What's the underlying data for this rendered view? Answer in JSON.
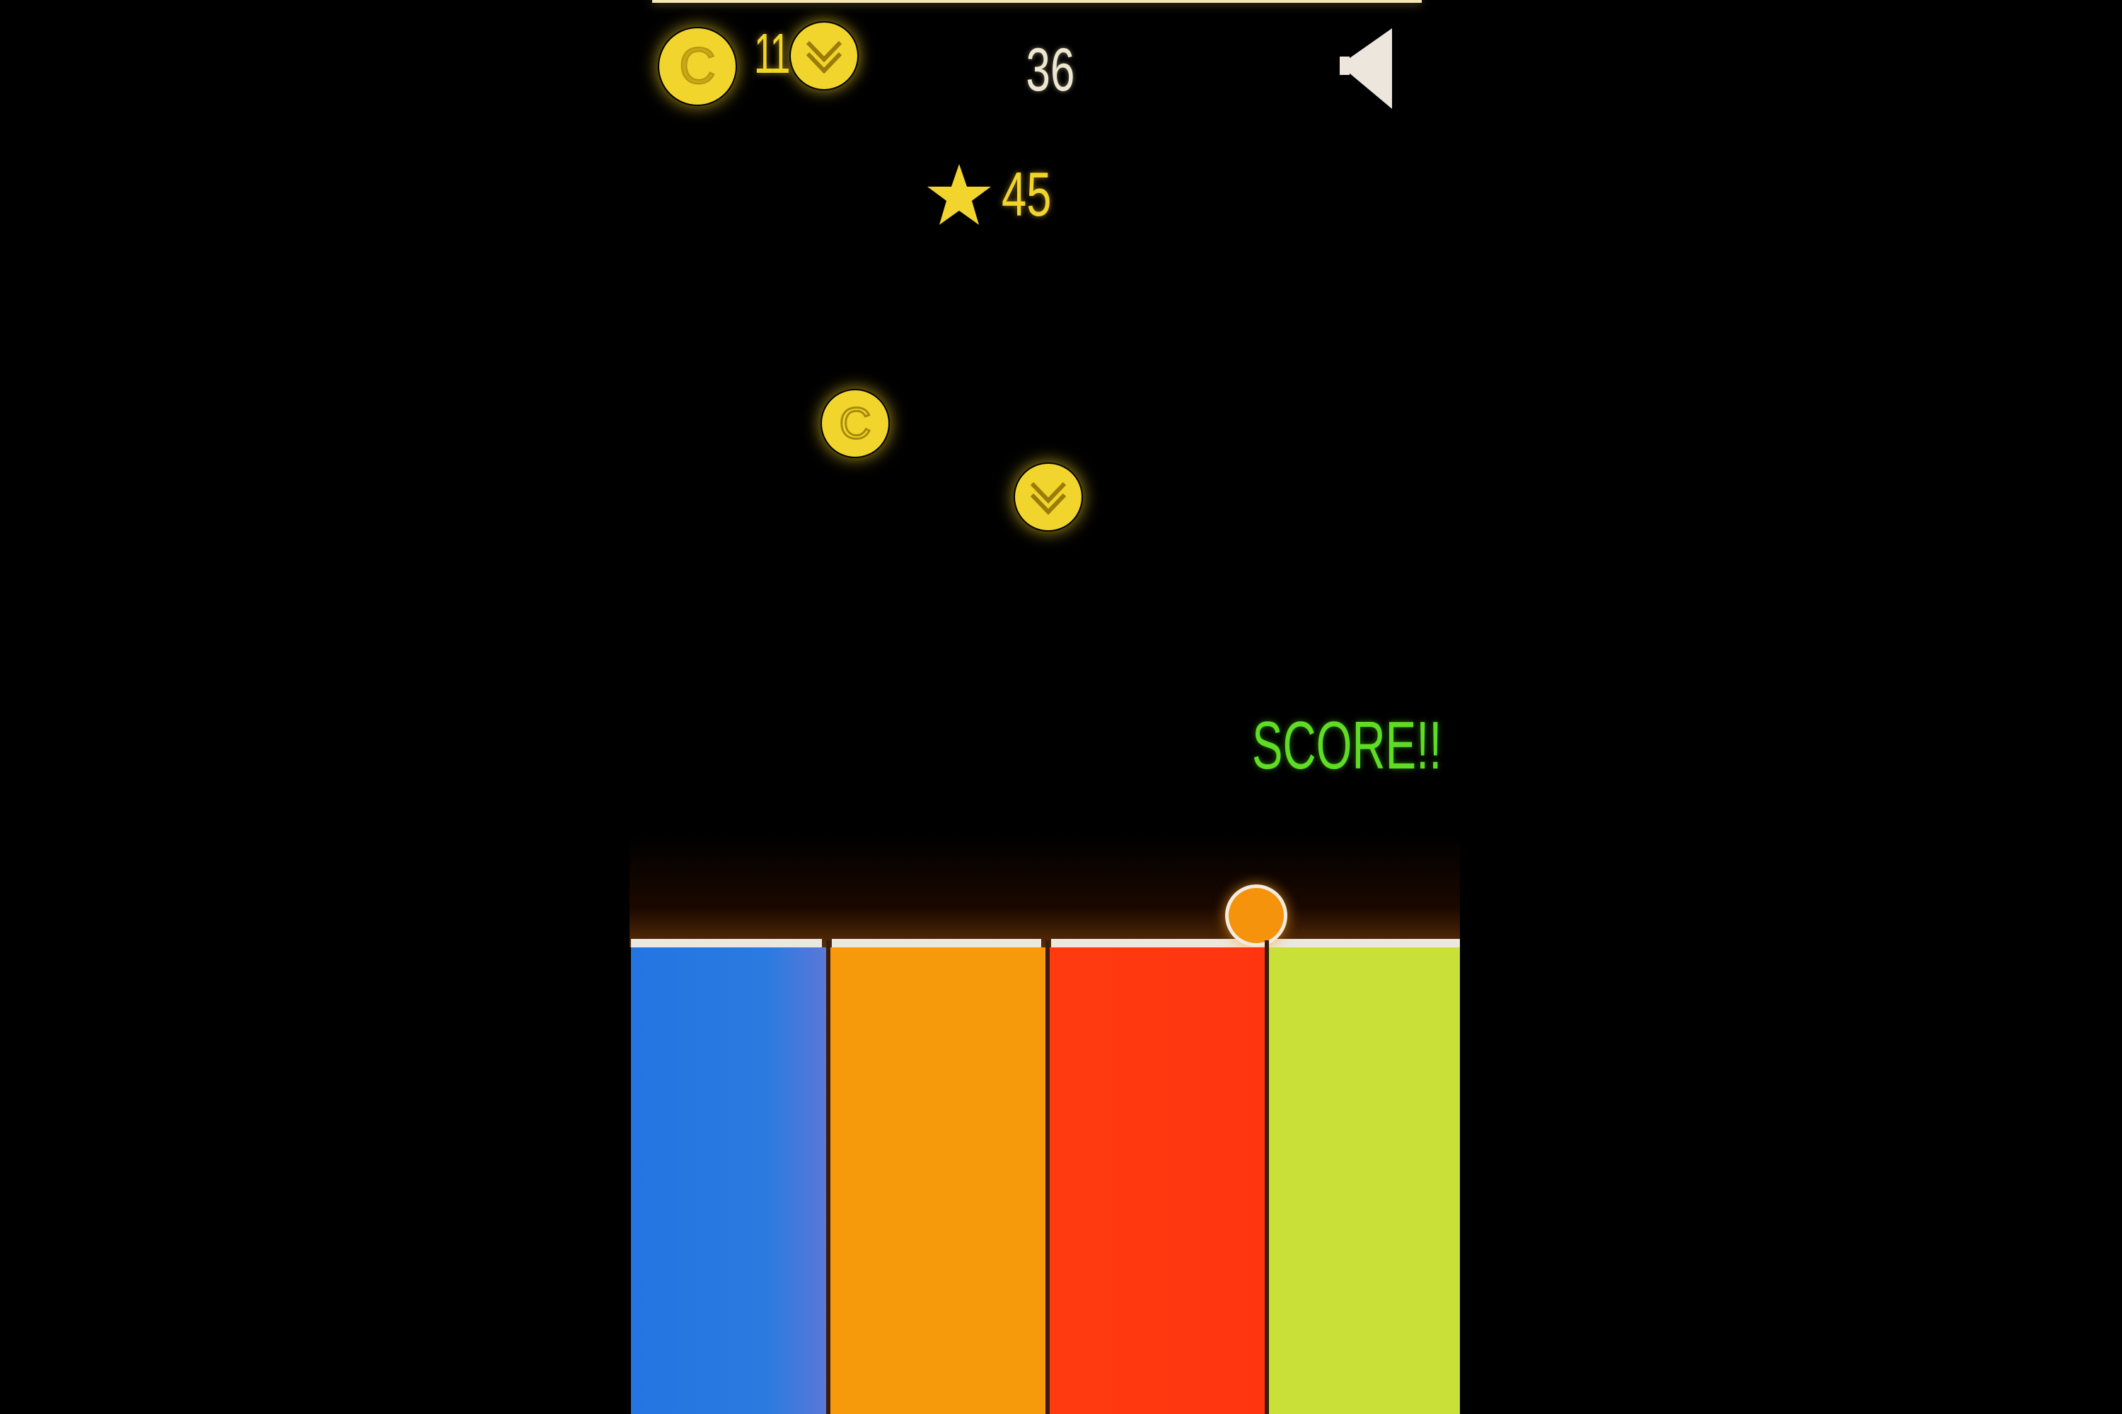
{
  "hud": {
    "coin_glyph": "C",
    "coin_count": "11",
    "level": "36",
    "sound_icon": "speaker-icon"
  },
  "best": {
    "value": "45",
    "icon": "star-icon"
  },
  "field": {
    "coin_glyph": "C",
    "score_popup": "SCORE!!"
  },
  "colors": {
    "gold": "#f1d52c",
    "blue": "#2b79e0",
    "orange": "#f69a0c",
    "red": "#ff3a10",
    "lime": "#c8e038",
    "ball": "#f5930c",
    "score_text": "#5fdc24"
  },
  "bars": [
    {
      "name": "blue",
      "color": "#2b79e0"
    },
    {
      "name": "orange",
      "color": "#f69a0c"
    },
    {
      "name": "red",
      "color": "#ff3a10"
    },
    {
      "name": "lime",
      "color": "#c8e038"
    }
  ]
}
